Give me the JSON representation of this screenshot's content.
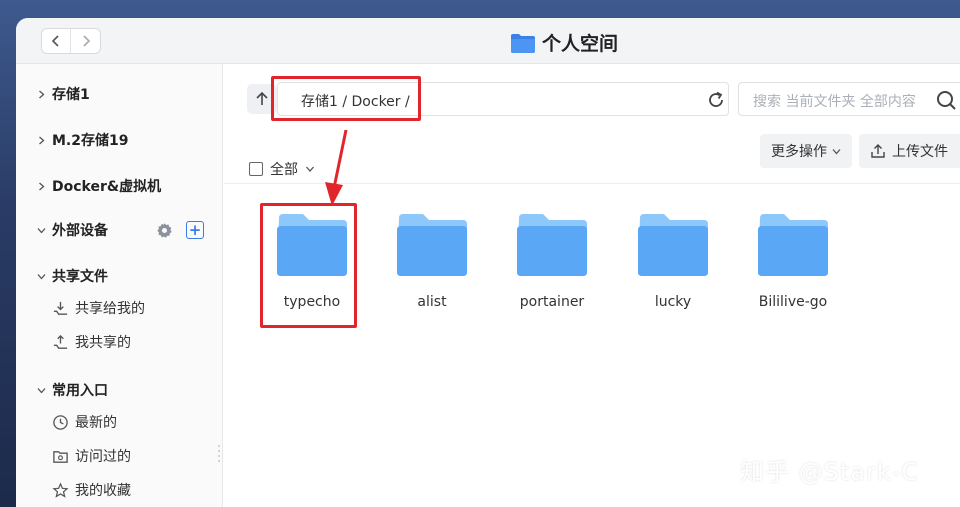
{
  "window": {
    "title": "个人空间",
    "title_icon": "folder-icon"
  },
  "nav": {
    "back_icon": "chevron-left-icon",
    "forward_icon": "chevron-right-icon"
  },
  "sidebar": {
    "storage1": "存储1",
    "m2_storage": "M.2存储19",
    "docker_vm": "Docker&虚拟机",
    "external": "外部设备",
    "external_add": "+",
    "shared_files": "共享文件",
    "shared_with_me": "共享给我的",
    "my_shared": "我共享的",
    "common": "常用入口",
    "recent": "最新的",
    "visited": "访问过的",
    "favorites": "我的收藏"
  },
  "toolbar": {
    "path": "存储1 / Docker /",
    "search_placeholder": "搜索 当前文件夹 全部内容",
    "select_all": "全部",
    "more_actions": "更多操作",
    "upload": "上传文件"
  },
  "folders": [
    {
      "name": "typecho"
    },
    {
      "name": "alist"
    },
    {
      "name": "portainer"
    },
    {
      "name": "lucky"
    },
    {
      "name": "Bililive-go"
    }
  ],
  "watermark": "知乎 @Stark-C",
  "colors": {
    "accent": "#3b7de6",
    "highlight": "#e0262b",
    "folder": "#5aa7f5"
  }
}
